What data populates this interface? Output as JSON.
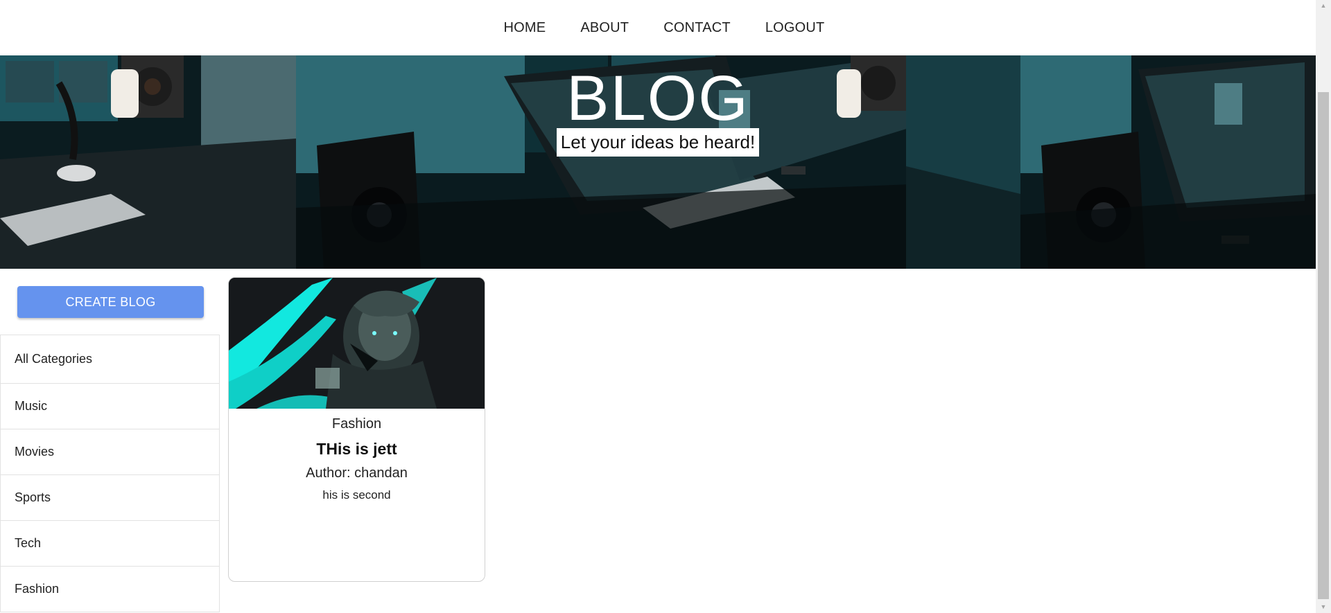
{
  "nav": {
    "items": [
      "HOME",
      "ABOUT",
      "CONTACT",
      "LOGOUT"
    ]
  },
  "hero": {
    "title": "BLOG",
    "subtitle": "Let your ideas be heard!"
  },
  "sidebar": {
    "create_button": "CREATE BLOG",
    "categories": [
      "All Categories",
      "Music",
      "Movies",
      "Sports",
      "Tech",
      "Fashion"
    ]
  },
  "posts": [
    {
      "category": "Fashion",
      "title": "THis is jett",
      "author": "Author: chandan",
      "description": "his is second"
    }
  ],
  "colors": {
    "accent_button": "#6593ee",
    "hero_teal": "#1a7a86",
    "card_art_cyan": "#19f1e8"
  }
}
